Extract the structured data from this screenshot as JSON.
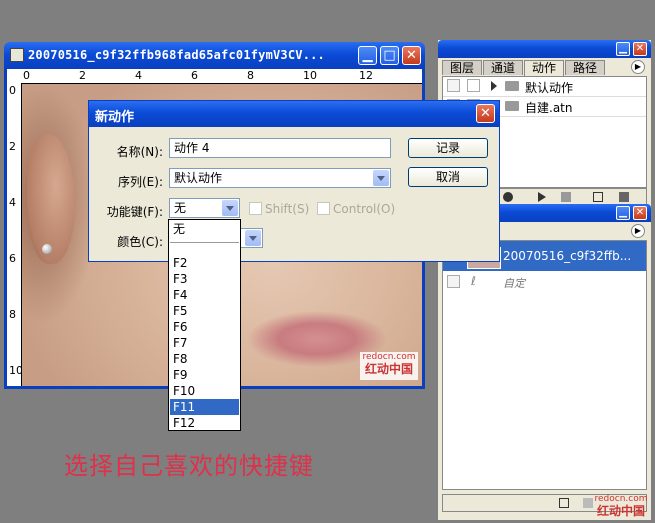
{
  "document_window": {
    "title": "20070516_c9f32ffb968fad65afc01fymV3CV...",
    "ruler_top": [
      "0",
      "2",
      "4",
      "6",
      "8",
      "10",
      "12"
    ],
    "ruler_left": [
      "0",
      "2",
      "4",
      "6",
      "8",
      "10"
    ],
    "watermark_site": "redocn.com",
    "watermark_name": "红动中国"
  },
  "actions_panel": {
    "tabs": [
      "图层",
      "通道",
      "动作",
      "路径"
    ],
    "active_tab": "动作",
    "items": [
      {
        "label": "默认动作"
      },
      {
        "label": "自建.atn"
      }
    ]
  },
  "history_panel": {
    "snapshot_label": "20070516_c9f32ffb...",
    "state_label": "自定",
    "watermark_site": "redocn.com",
    "watermark_name": "红动中国"
  },
  "dialog": {
    "title": "新动作",
    "name_label": "名称(N):",
    "name_value": "动作 4",
    "set_label": "序列(E):",
    "set_value": "默认动作",
    "fkey_label": "功能键(F):",
    "fkey_value": "无",
    "shift_label": "Shift(S)",
    "control_label": "Control(O)",
    "color_label": "颜色(C):",
    "record_button": "记录",
    "cancel_button": "取消"
  },
  "fkey_options": [
    "无",
    "F2",
    "F3",
    "F4",
    "F5",
    "F6",
    "F7",
    "F8",
    "F9",
    "F10",
    "F11",
    "F12"
  ],
  "fkey_selected": "F11",
  "caption": "选择自己喜欢的快捷键",
  "colors": {
    "titlebar": "#0b4bd6",
    "selection": "#316ac5",
    "caption": "#e0304a"
  }
}
